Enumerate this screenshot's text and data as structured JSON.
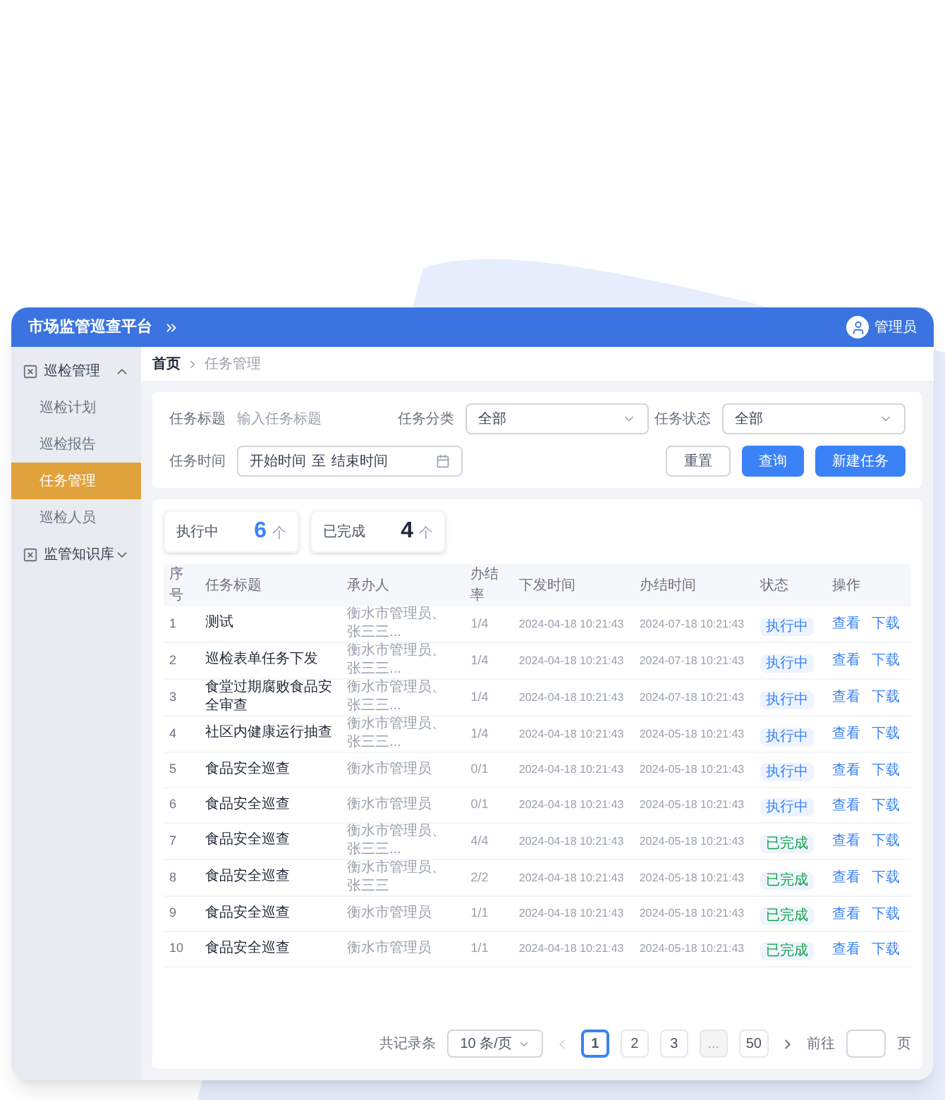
{
  "app": {
    "title": "市场监管巡查平台",
    "user": "管理员"
  },
  "sidebar": {
    "items": [
      {
        "label": "巡检管理",
        "expanded": true,
        "children": [
          {
            "label": "巡检计划",
            "selected": false
          },
          {
            "label": "巡检报告",
            "selected": false
          },
          {
            "label": "任务管理",
            "selected": true
          },
          {
            "label": "巡检人员",
            "selected": false
          }
        ]
      },
      {
        "label": "监管知识库",
        "expanded": false
      }
    ]
  },
  "breadcrumb": [
    "首页",
    "任务管理"
  ],
  "filters": {
    "title_label": "任务标题",
    "title_placeholder": "输入任务标题",
    "category_label": "任务分类",
    "category_value": "全部",
    "status_label": "任务状态",
    "status_value": "全部",
    "time_label": "任务时间",
    "time_start": "开始时间",
    "time_sep": "至",
    "time_end": "结束时间"
  },
  "buttons": {
    "reset": "重置",
    "search": "查询",
    "create": "新建任务"
  },
  "stats": [
    {
      "label": "执行中",
      "count": "6",
      "unit": "个",
      "color": "#3b82f6"
    },
    {
      "label": "已完成",
      "count": "4",
      "unit": "个",
      "color": "#1f2937"
    }
  ],
  "table": {
    "columns": [
      "序号",
      "任务标题",
      "承办人",
      "办结率",
      "下发时间",
      "办结时间",
      "状态",
      "操作"
    ],
    "rows": [
      {
        "no": "1",
        "title": "测试",
        "assignee": "衡水市管理员、张三三...",
        "rate": "1/4",
        "issued": "2024-04-18 10:21:43",
        "due": "2024-07-18 10:21:43",
        "status": {
          "label": "执行中",
          "color": "#3b82f6"
        },
        "actions": [
          "查看",
          "下载"
        ]
      },
      {
        "no": "2",
        "title": "巡检表单任务下发",
        "assignee": "衡水市管理员、张三三...",
        "rate": "1/4",
        "issued": "2024-04-18 10:21:43",
        "due": "2024-07-18 10:21:43",
        "status": {
          "label": "执行中",
          "color": "#3b82f6"
        },
        "actions": [
          "查看",
          "下载"
        ]
      },
      {
        "no": "3",
        "title": "食堂过期腐败食品安全审查",
        "assignee": "衡水市管理员、张三三...",
        "rate": "1/4",
        "issued": "2024-04-18 10:21:43",
        "due": "2024-07-18 10:21:43",
        "status": {
          "label": "执行中",
          "color": "#3b82f6"
        },
        "actions": [
          "查看",
          "下载"
        ]
      },
      {
        "no": "4",
        "title": "社区内健康运行抽查",
        "assignee": "衡水市管理员、张三三...",
        "rate": "1/4",
        "issued": "2024-04-18 10:21:43",
        "due": "2024-05-18 10:21:43",
        "status": {
          "label": "执行中",
          "color": "#3b82f6"
        },
        "actions": [
          "查看",
          "下载"
        ]
      },
      {
        "no": "5",
        "title": "食品安全巡查",
        "assignee": "衡水市管理员",
        "rate": "0/1",
        "issued": "2024-04-18 10:21:43",
        "due": "2024-05-18 10:21:43",
        "status": {
          "label": "执行中",
          "color": "#3b82f6"
        },
        "actions": [
          "查看",
          "下载"
        ]
      },
      {
        "no": "6",
        "title": "食品安全巡查",
        "assignee": "衡水市管理员",
        "rate": "0/1",
        "issued": "2024-04-18 10:21:43",
        "due": "2024-05-18 10:21:43",
        "status": {
          "label": "执行中",
          "color": "#3b82f6"
        },
        "actions": [
          "查看",
          "下载"
        ]
      },
      {
        "no": "7",
        "title": "食品安全巡查",
        "assignee": "衡水市管理员、张三三...",
        "rate": "4/4",
        "issued": "2024-04-18 10:21:43",
        "due": "2024-05-18 10:21:43",
        "status": {
          "label": "已完成",
          "color": "#16a34a"
        },
        "actions": [
          "查看",
          "下载"
        ]
      },
      {
        "no": "8",
        "title": "食品安全巡查",
        "assignee": "衡水市管理员、张三三",
        "rate": "2/2",
        "issued": "2024-04-18 10:21:43",
        "due": "2024-05-18 10:21:43",
        "status": {
          "label": "已完成",
          "color": "#16a34a"
        },
        "actions": [
          "查看",
          "下载"
        ]
      },
      {
        "no": "9",
        "title": "食品安全巡查",
        "assignee": "衡水市管理员",
        "rate": "1/1",
        "issued": "2024-04-18 10:21:43",
        "due": "2024-05-18 10:21:43",
        "status": {
          "label": "已完成",
          "color": "#16a34a"
        },
        "actions": [
          "查看",
          "下载"
        ]
      },
      {
        "no": "10",
        "title": "食品安全巡查",
        "assignee": "衡水市管理员",
        "rate": "1/1",
        "issued": "2024-04-18 10:21:43",
        "due": "2024-05-18 10:21:43",
        "status": {
          "label": "已完成",
          "color": "#16a34a"
        },
        "actions": [
          "查看",
          "下载"
        ]
      }
    ]
  },
  "pagination": {
    "total": "共记录条",
    "page_size": "10 条/页",
    "pages": [
      {
        "label": "1",
        "kind": "page",
        "selected": true
      },
      {
        "label": "2",
        "kind": "page",
        "selected": false
      },
      {
        "label": "3",
        "kind": "page",
        "selected": false
      },
      {
        "label": "...",
        "kind": "gap",
        "selected": false
      },
      {
        "label": "50",
        "kind": "page",
        "selected": false
      }
    ],
    "goto": "前往",
    "goto_unit": "页"
  }
}
